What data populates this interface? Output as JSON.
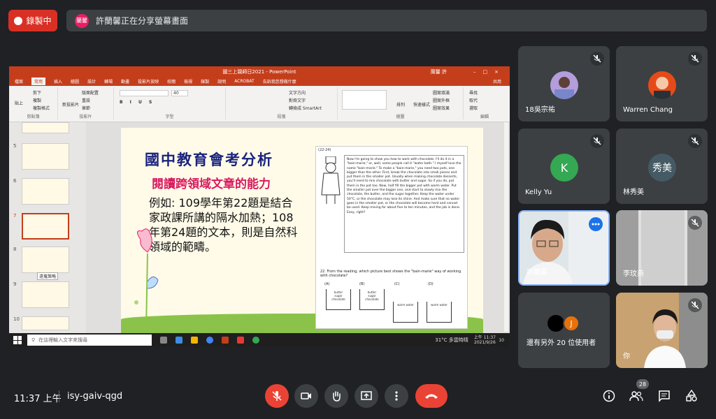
{
  "recording": {
    "label": "錄製中"
  },
  "share_banner": {
    "avatar_text": "蘭馨",
    "text": "許蘭馨正在分享螢幕畫面"
  },
  "presentation": {
    "window_title": "國三上親師日2021 - PowerPoint",
    "user": "蘭馨 許",
    "tabs": [
      "檔案",
      "常用",
      "插入",
      "繪圖",
      "設計",
      "轉場",
      "動畫",
      "投影片放映",
      "校閱",
      "檢視",
      "錄製",
      "說明",
      "ACROBAT",
      "告訴我您想做什麼"
    ],
    "share_label": "共用",
    "ribbon_groups": [
      "剪貼簿",
      "投影片",
      "字型",
      "段落",
      "繪圖",
      "編輯"
    ],
    "ribbon_items": {
      "paste": "貼上",
      "cut": "剪下",
      "copy": "複製",
      "format_painter": "複製格式",
      "new_slide": "新投影片",
      "layout": "版面配置",
      "reset": "重設",
      "section": "章節",
      "font_size": "40",
      "text_direction": "文字方向",
      "align_text": "對齊文字",
      "smartart": "轉換成 SmartArt",
      "arrange": "排列",
      "quick_styles": "快速樣式",
      "shape_fill": "圖案填滿",
      "shape_outline": "圖案外框",
      "shape_effects": "圖案效果",
      "find": "尋找",
      "replace": "取代",
      "select": "選取"
    },
    "thumbnails": [
      {
        "num": "5"
      },
      {
        "num": "6"
      },
      {
        "num": "7"
      },
      {
        "num": "8"
      },
      {
        "num": "9"
      },
      {
        "num": "10"
      }
    ],
    "tooltip": "遠蒐策略",
    "slide": {
      "title": "國中教育會考分析",
      "subtitle": "閱讀跨領域文章的能力",
      "body": "例如: 109學年第22題是結合家政課所講的隔水加熱；108年第24題的文本，則是自然科領域的範疇。",
      "exam_page": "(22-24)",
      "passage": "Now I'm going to show you how to work with chocolate. I'll do it in a \"bain-marie,\" or, well, some people call it \"water bath.\" I myself love the name \"bain-marie.\" To make a \"bain-marie,\" you need two pots, one bigger than the other. First, break the chocolate into small pieces and put them in the smaller pot. Usually when making chocolate desserts, you'll need to mix chocolate with butter and sugar. So if you do, put them in the pot too. Now, half fill the bigger pot with warm water. Put the smaller pot over the bigger one, and start to slowly mix the chocolate, the butter, and the sugar together. Keep the water under 50°C, or the chocolate may lose its shine. And make sure that no water goes in the smaller pot, or the chocolate will become hard and cannot be used. Keep mixing for about five to ten minutes, and the job is done. Easy, right?",
      "question": "22. From the reading, which picture best shows the \"bain-marie\" way of working with chocolate?",
      "options": [
        "(A)",
        "(B)",
        "(C)",
        "(D)"
      ],
      "cup_labels": [
        "butter",
        "sugar",
        "chocolate",
        "warm water"
      ]
    },
    "taskbar": {
      "search_placeholder": "在這裡輸入文字來搜尋",
      "weather": "31°C 多雲時晴",
      "time": "上午 11:37",
      "date": "2021/9/26",
      "notif": "10"
    }
  },
  "participants": [
    {
      "name": "18吳宗祐",
      "muted": true
    },
    {
      "name": "Warren Chang",
      "muted": true
    },
    {
      "name": "Kelly Yu",
      "initial": "K",
      "muted": true
    },
    {
      "name": "林秀美",
      "initial": "秀美",
      "muted": true
    },
    {
      "name": "許蘭馨",
      "muted": false
    },
    {
      "name": "李玟燕",
      "muted": true
    },
    {
      "name": "還有另外 20 位使用者",
      "initial": "J"
    },
    {
      "name": "你",
      "muted": true
    }
  ],
  "colors": {
    "kelly": "#34a853",
    "xiumei": "#455a64",
    "others_j": "#e8710a"
  },
  "bottom": {
    "time": "11:37 上午",
    "meeting_code": "isy-gaiv-qgd",
    "people_count": "28"
  }
}
